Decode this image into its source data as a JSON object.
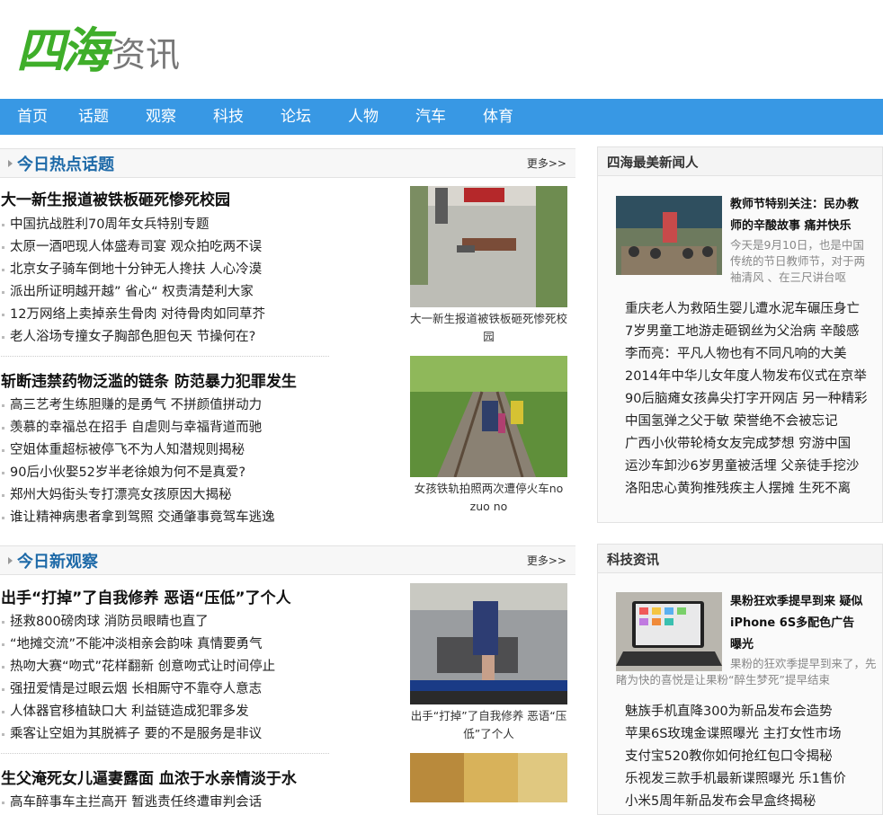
{
  "logo": {
    "mark": "四海",
    "sub": "资讯"
  },
  "nav": [
    "首页",
    "话题",
    "观察",
    "科技",
    "论坛",
    "人物",
    "汽车",
    "体育"
  ],
  "hot": {
    "title": "今日热点话题",
    "more": "更多>>",
    "groups": [
      {
        "headline": "大一新生报道被铁板砸死惨死校园",
        "items": [
          "中国抗战胜利70周年女兵特别专题",
          "太原一酒吧现人体盛寿司宴 观众拍吃两不误",
          "北京女子骑车倒地十分钟无人搀扶 人心冷漠",
          "派出所证明越开越” 省心“ 权责清楚利大家",
          "12万网络上卖掉亲生骨肉 对待骨肉如同草芥",
          "老人浴场专撞女子胸部色胆包天 节操何在?"
        ],
        "caption": "大一新生报道被铁板砸死惨死校园"
      },
      {
        "headline": "斩断违禁药物泛滥的链条 防范暴力犯罪发生",
        "items": [
          "高三艺考生练胆赚的是勇气 不拼颜值拼动力",
          "羡慕的幸福总在招手 自虐则与幸福背道而驰",
          "空姐体重超标被停飞不为人知潜规则揭秘",
          "90后小伙娶52岁半老徐娘为何不是真爱?",
          "郑州大妈街头专打漂亮女孩原因大揭秘",
          "谁让精神病患者拿到驾照 交通肇事竟驾车逃逸"
        ],
        "caption": "女孩铁轨拍照两次遭停火车no zuo no"
      }
    ]
  },
  "observe": {
    "title": "今日新观察",
    "more": "更多>>",
    "groups": [
      {
        "headline": "出手“打掉”了自我修养 恶语“压低”了个人",
        "items": [
          "拯救800磅肉球 消防员眼睛也直了",
          "“地摊交流”不能冲淡相亲会韵味 真情要勇气",
          "热吻大赛“吻式”花样翻新 创意吻式让时间停止",
          "强扭爱情是过眼云烟 长相厮守不靠夺人意志",
          "人体器官移植缺口大 利益链造成犯罪多发",
          "乘客让空姐为其脱裤子 要的不是服务是非议"
        ],
        "caption": "出手“打掉”了自我修养 恶语“压低”了个人"
      },
      {
        "headline": "生父淹死女儿逼妻露面 血浓于水亲情淡于水",
        "items": [
          "高车醉事车主拦高开 暂逃责任终遭审判会话"
        ],
        "caption": ""
      }
    ]
  },
  "people": {
    "title": "四海最美新闻人",
    "feature_title": "教师节特别关注：民办教师的辛酸故事 痛并快乐",
    "feature_desc": "今天是9月10日，也是中国传统的节日教师节，对于两袖清风 、在三尺讲台呕",
    "items": [
      "重庆老人为救陌生婴儿遭水泥车碾压身亡",
      "7岁男童工地游走砸钢丝为父治病 辛酸感",
      "李而亮：平凡人物也有不同凡响的大美",
      "2014年中华儿女年度人物发布仪式在京举",
      "90后脑瘫女孩鼻尖打字开网店 另一种精彩",
      "中国氢弹之父于敏 荣誉绝不会被忘记",
      "广西小伙带轮椅女友完成梦想 穷游中国",
      "运沙车卸沙6岁男童被活埋 父亲徒手挖沙",
      "洛阳忠心黄狗推残疾主人摆摊 生死不离"
    ]
  },
  "tech": {
    "title": "科技资讯",
    "feature_title": "果粉狂欢季提早到来 疑似iPhone 6S多配色广告曝光",
    "feature_desc": "果粉的狂欢季提早到来了，先睹为快的喜悦是让果粉“醉生梦死”提早结束",
    "items": [
      "魅族手机直降300为新品发布会造势",
      "苹果6S玫瑰金谍照曝光 主打女性市场",
      "支付宝520教你如何抢红包口令揭秘",
      "乐视发三款手机最新谍照曝光 乐1售价",
      "小米5周年新品发布会早盒终揭秘"
    ]
  }
}
